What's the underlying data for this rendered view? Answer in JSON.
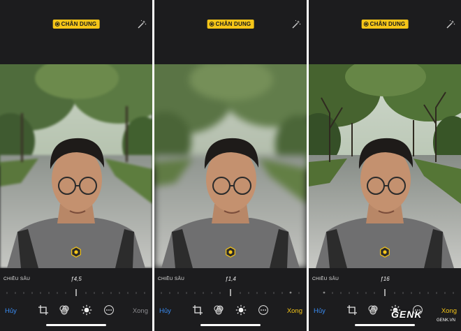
{
  "panels": [
    {
      "mode_label": "CHÂN DUNG",
      "depth_label": "CHIỀU SÂU",
      "aperture": "ƒ4,5",
      "cancel_label": "Hủy",
      "done_label": "Xong",
      "done_state": "disabled"
    },
    {
      "mode_label": "CHÂN DUNG",
      "depth_label": "CHIỀU SÂU",
      "aperture": "ƒ1,4",
      "cancel_label": "Hủy",
      "done_label": "Xong",
      "done_state": "enabled"
    },
    {
      "mode_label": "CHÂN DUNG",
      "depth_label": "CHIỀU SÂU",
      "aperture": "ƒ16",
      "cancel_label": "Hủy",
      "done_label": "Xong",
      "done_state": "enabled"
    }
  ],
  "watermark": {
    "logo": "GENK",
    "site": "GENK.VN"
  },
  "icons": {
    "mode": "cube-icon",
    "auto_enhance": "magic-wand-icon",
    "portrait_lighting": "hexagon-light-icon",
    "crop": "crop-rotate-icon",
    "filters": "filters-icon",
    "adjust": "adjust-dial-icon",
    "more": "more-ellipsis-icon"
  },
  "colors": {
    "accent_yellow": "#f5c518",
    "link_blue": "#3a8ef6",
    "toolbar_bg": "#1c1c1e"
  }
}
